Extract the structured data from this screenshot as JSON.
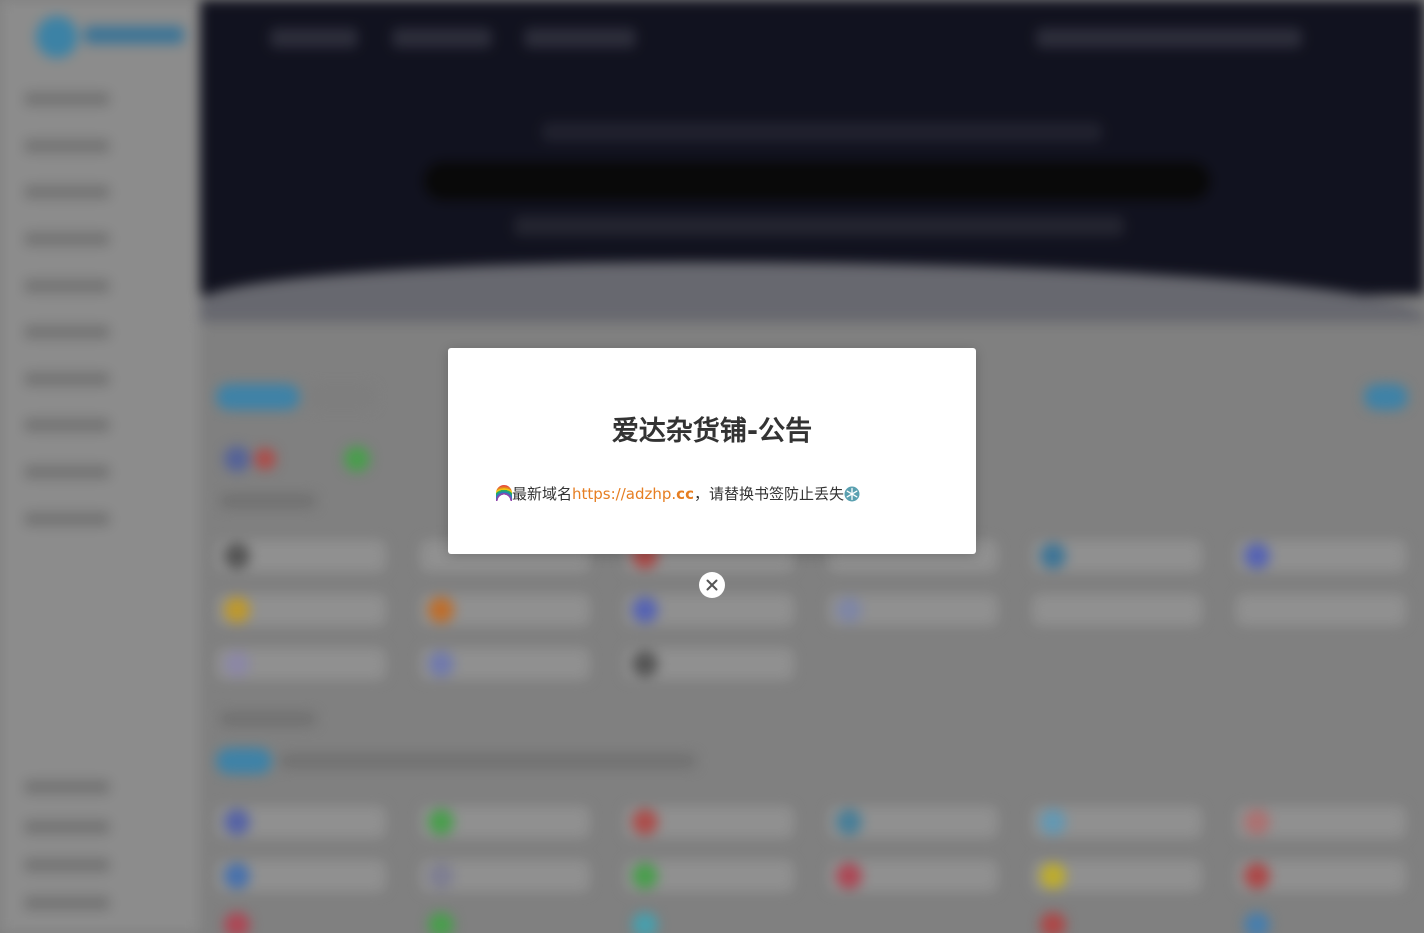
{
  "modal": {
    "title": "爱达杂货铺-公告",
    "body_prefix": "最新域名",
    "link_main": "https://adzhp.",
    "link_suffix": "cc",
    "body_suffix": "，请替换书签防止丢失",
    "leading_icon": "rainbow-icon",
    "trailing_icon": "snowflake-icon"
  },
  "close_button": {
    "icon": "close-icon"
  },
  "colors": {
    "link": "#e67e22",
    "title": "#333333",
    "modal_background": "#ffffff"
  }
}
